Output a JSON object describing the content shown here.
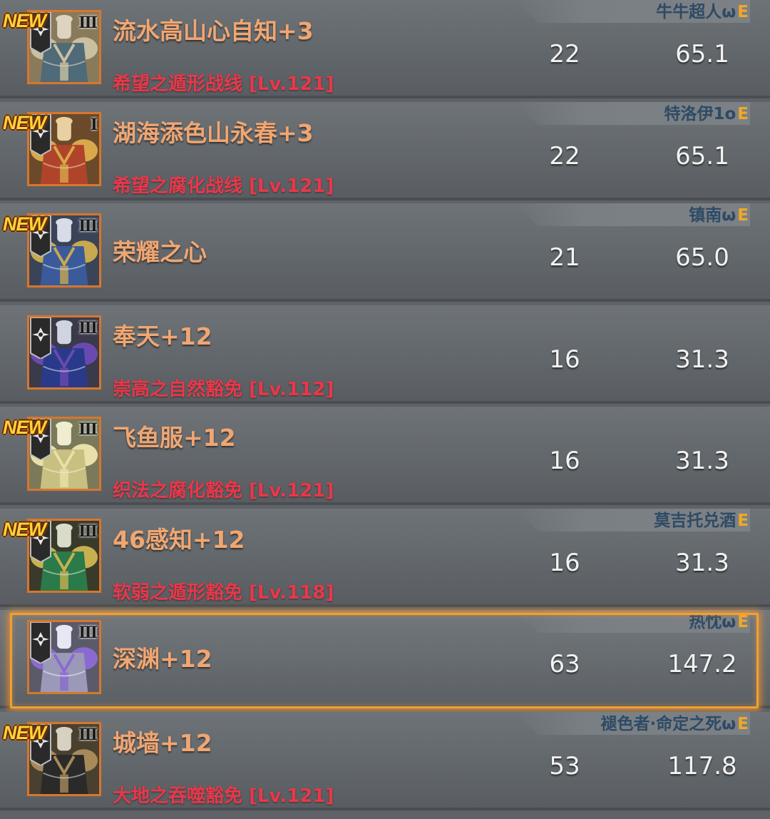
{
  "colors": {
    "name": "#f0a672",
    "affix": "#e8384a",
    "owner": "#2d4a66",
    "grade": "#f0a828",
    "new_badge": "#ffd23a",
    "selected_border": "#f0a030"
  },
  "items": [
    {
      "new": true,
      "new_label": "NEW",
      "tier": "III",
      "name": "流水高山心自知+3",
      "affix": "希望之遁形战线 [Lv.121]",
      "owner": "牛牛超人ω",
      "grade": "E",
      "stat1": "22",
      "stat2": "65.1",
      "icon": "armor-teal-robe-icon",
      "selected": false
    },
    {
      "new": true,
      "new_label": "NEW",
      "tier": "I",
      "name": "湖海添色山永春+3",
      "affix": "希望之腐化战线 [Lv.121]",
      "owner": "特洛伊1o",
      "grade": "E",
      "stat1": "22",
      "stat2": "65.1",
      "icon": "armor-red-gold-icon",
      "selected": false
    },
    {
      "new": true,
      "new_label": "NEW",
      "tier": "III",
      "name": "荣耀之心",
      "affix": "",
      "owner": "镇南ω",
      "grade": "E",
      "stat1": "21",
      "stat2": "65.0",
      "icon": "armor-blue-plate-icon",
      "selected": false
    },
    {
      "new": false,
      "new_label": "",
      "tier": "III",
      "name": "奉天+12",
      "affix": "崇高之自然豁免 [Lv.112]",
      "owner": "",
      "grade": "",
      "stat1": "16",
      "stat2": "31.3",
      "icon": "armor-purple-blue-icon",
      "selected": false
    },
    {
      "new": true,
      "new_label": "NEW",
      "tier": "III",
      "name": "飞鱼服+12",
      "affix": "织法之腐化豁免 [Lv.121]",
      "owner": "",
      "grade": "",
      "stat1": "16",
      "stat2": "31.3",
      "icon": "armor-gold-leaf-icon",
      "selected": false
    },
    {
      "new": true,
      "new_label": "NEW",
      "tier": "III",
      "name": "46感知+12",
      "affix": "软弱之遁形豁免 [Lv.118]",
      "owner": "莫吉托兑酒",
      "grade": "E",
      "stat1": "16",
      "stat2": "31.3",
      "icon": "armor-green-leaf-icon",
      "selected": false
    },
    {
      "new": false,
      "new_label": "",
      "tier": "III",
      "name": "深渊+12",
      "affix": "",
      "owner": "热忱ω",
      "grade": "E",
      "stat1": "63",
      "stat2": "147.2",
      "icon": "armor-abyss-crystal-icon",
      "selected": true
    },
    {
      "new": true,
      "new_label": "NEW",
      "tier": "III",
      "name": "城墙+12",
      "affix": "大地之吞噬豁免 [Lv.121]",
      "owner": "褪色者·命定之死ω",
      "grade": "E",
      "stat1": "53",
      "stat2": "117.8",
      "icon": "armor-dark-fur-icon",
      "selected": false
    }
  ]
}
